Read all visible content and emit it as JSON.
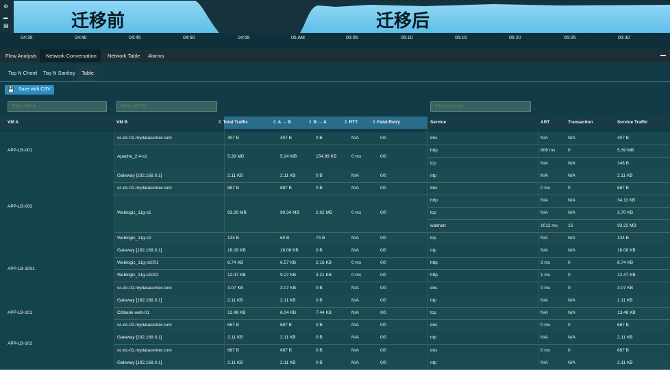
{
  "timeline": {
    "banner_before": "迁移前",
    "banner_after": "迁移后",
    "ticks": [
      "04:35",
      "04:40",
      "04:45",
      "04:50",
      "04:55",
      "05 AM",
      "05:05",
      "05:10",
      "05:15",
      "05:20",
      "05:25",
      "05:30"
    ]
  },
  "tabs": [
    "Flow Analysis",
    "Network Conversation",
    "Network Table",
    "Alarms"
  ],
  "subtabs": [
    "Top N Chord",
    "Top N Sankey",
    "Table"
  ],
  "toolbar": {
    "save_label": "Save with CSV"
  },
  "filters": {
    "vm_a": "Filter VM A",
    "vm_b": "Filter VM B",
    "service": "Filter Service"
  },
  "columns": [
    "VM A",
    "VM B",
    "Total Traffic",
    "A → B",
    "B → A",
    "RTT",
    "Fatal Retry",
    "Service",
    "ART",
    "Transaction",
    "Service Traffic"
  ],
  "groups": [
    {
      "vm_a": "APP-LB-001",
      "rows": [
        {
          "vm_b": "sc-dc-01.mydatacenter.com",
          "total": "407 B",
          "ab": "407 B",
          "ba": "0 B",
          "rtt": "N/A",
          "retry": "0/0",
          "services": [
            {
              "service": "dns",
              "art": "N/A",
              "trans": "N/A",
              "traffic": "407 B"
            }
          ]
        },
        {
          "vm_b": "Apache_2.4-s1",
          "total": "5.39 MB",
          "ab": "5.24 MB",
          "ba": "154.99 KB",
          "rtt": "0 ms",
          "retry": "0/0",
          "services": [
            {
              "service": "http",
              "art": "806 ms",
              "trans": "0",
              "traffic": "5.39 MB"
            },
            {
              "service": "tcp",
              "art": "N/A",
              "trans": "N/A",
              "traffic": "148 B"
            }
          ]
        }
      ]
    },
    {
      "vm_a": "APP-LB-002",
      "rows": [
        {
          "vm_b": "Gateway [192.168.0.1]",
          "total": "2.11 KB",
          "ab": "2.11 KB",
          "ba": "0 B",
          "rtt": "N/A",
          "retry": "0/0",
          "services": [
            {
              "service": "ntp",
              "art": "N/A",
              "trans": "N/A",
              "traffic": "2.11 KB"
            }
          ]
        },
        {
          "vm_b": "sc-dc-01.mydatacenter.com",
          "total": "687 B",
          "ab": "687 B",
          "ba": "0 B",
          "rtt": "N/A",
          "retry": "0/0",
          "services": [
            {
              "service": "dns",
              "art": "0 ms",
              "trans": "0",
              "traffic": "687 B"
            }
          ]
        },
        {
          "vm_b": "Weblogic_11g-s1",
          "total": "93.26 MB",
          "ab": "90.34 MB",
          "ba": "2.92 MB",
          "rtt": "0 ms",
          "retry": "0/0",
          "services": [
            {
              "service": "http",
              "art": "N/A",
              "trans": "N/A",
              "traffic": "34.11 KB"
            },
            {
              "service": "tcp",
              "art": "N/A",
              "trans": "N/A",
              "traffic": "3.70 KB"
            },
            {
              "service": "walmart",
              "art": "1012 ms",
              "trans": "16",
              "traffic": "93.22 MB"
            }
          ]
        },
        {
          "vm_b": "Weblogic_11g-s2",
          "total": "134 B",
          "ab": "60 B",
          "ba": "74 B",
          "rtt": "N/A",
          "retry": "0/0",
          "services": [
            {
              "service": "tcp",
              "art": "N/A",
              "trans": "N/A",
              "traffic": "134 B"
            }
          ]
        }
      ]
    },
    {
      "vm_a": "APP-LB-1001",
      "rows": [
        {
          "vm_b": "Gateway [192.168.0.1]",
          "total": "16.08 KB",
          "ab": "16.08 KB",
          "ba": "0 B",
          "rtt": "N/A",
          "retry": "0/0",
          "services": [
            {
              "service": "ntp",
              "art": "N/A",
              "trans": "N/A",
              "traffic": "16.08 KB"
            }
          ]
        },
        {
          "vm_b": "Weblogic_11g-s1001",
          "total": "8.74 KB",
          "ab": "6.57 KB",
          "ba": "2.16 KB",
          "rtt": "0 ms",
          "retry": "0/0",
          "services": [
            {
              "service": "http",
              "art": "3 ms",
              "trans": "0",
              "traffic": "8.74 KB"
            }
          ]
        },
        {
          "vm_b": "Weblogic_11g-s1002",
          "total": "12.47 KB",
          "ab": "9.27 KB",
          "ba": "3.21 KB",
          "rtt": "0 ms",
          "retry": "0/0",
          "services": [
            {
              "service": "http",
              "art": "1 ms",
              "trans": "0",
              "traffic": "12.47 KB"
            }
          ]
        },
        {
          "vm_b": "sc-dc-01.mydatacenter.com",
          "total": "3.07 KB",
          "ab": "3.07 KB",
          "ba": "0 B",
          "rtt": "N/A",
          "retry": "0/0",
          "services": [
            {
              "service": "dns",
              "art": "0 ms",
              "trans": "0",
              "traffic": "3.07 KB"
            }
          ]
        }
      ]
    },
    {
      "vm_a": "APP-LB-101",
      "rows": [
        {
          "vm_b": "Gateway [192.168.0.1]",
          "total": "2.11 KB",
          "ab": "2.11 KB",
          "ba": "0 B",
          "rtt": "N/A",
          "retry": "0/0",
          "services": [
            {
              "service": "ntp",
              "art": "N/A",
              "trans": "N/A",
              "traffic": "2.11 KB"
            }
          ]
        },
        {
          "vm_b": "Citibank-web-01",
          "total": "13.48 KB",
          "ab": "6.04 KB",
          "ba": "7.44 KB",
          "rtt": "N/A",
          "retry": "0/0",
          "services": [
            {
              "service": "tcp",
              "art": "N/A",
              "trans": "N/A",
              "traffic": "13.48 KB"
            }
          ]
        },
        {
          "vm_b": "sc-dc-01.mydatacenter.com",
          "total": "687 B",
          "ab": "687 B",
          "ba": "0 B",
          "rtt": "N/A",
          "retry": "0/0",
          "services": [
            {
              "service": "dns",
              "art": "0 ms",
              "trans": "0",
              "traffic": "687 B"
            }
          ]
        }
      ]
    },
    {
      "vm_a": "APP-LB-102",
      "rows": [
        {
          "vm_b": "Gateway [192.168.0.1]",
          "total": "2.11 KB",
          "ab": "2.11 KB",
          "ba": "0 B",
          "rtt": "N/A",
          "retry": "0/0",
          "services": [
            {
              "service": "ntp",
              "art": "N/A",
              "trans": "N/A",
              "traffic": "2.11 KB"
            }
          ]
        },
        {
          "vm_b": "sc-dc-01.mydatacenter.com",
          "total": "687 B",
          "ab": "687 B",
          "ba": "0 B",
          "rtt": "N/A",
          "retry": "0/0",
          "services": [
            {
              "service": "dns",
              "art": "0 ms",
              "trans": "0",
              "traffic": "687 B"
            }
          ]
        }
      ]
    },
    {
      "vm_a": "",
      "rows": [
        {
          "vm_b": "Gateway [192.168.0.1]",
          "total": "2.11 KB",
          "ab": "2.11 KB",
          "ba": "0 B",
          "rtt": "N/A",
          "retry": "0/0",
          "services": [
            {
              "service": "ntp",
              "art": "N/A",
              "trans": "N/A",
              "traffic": "2.11 KB"
            }
          ]
        }
      ]
    }
  ]
}
